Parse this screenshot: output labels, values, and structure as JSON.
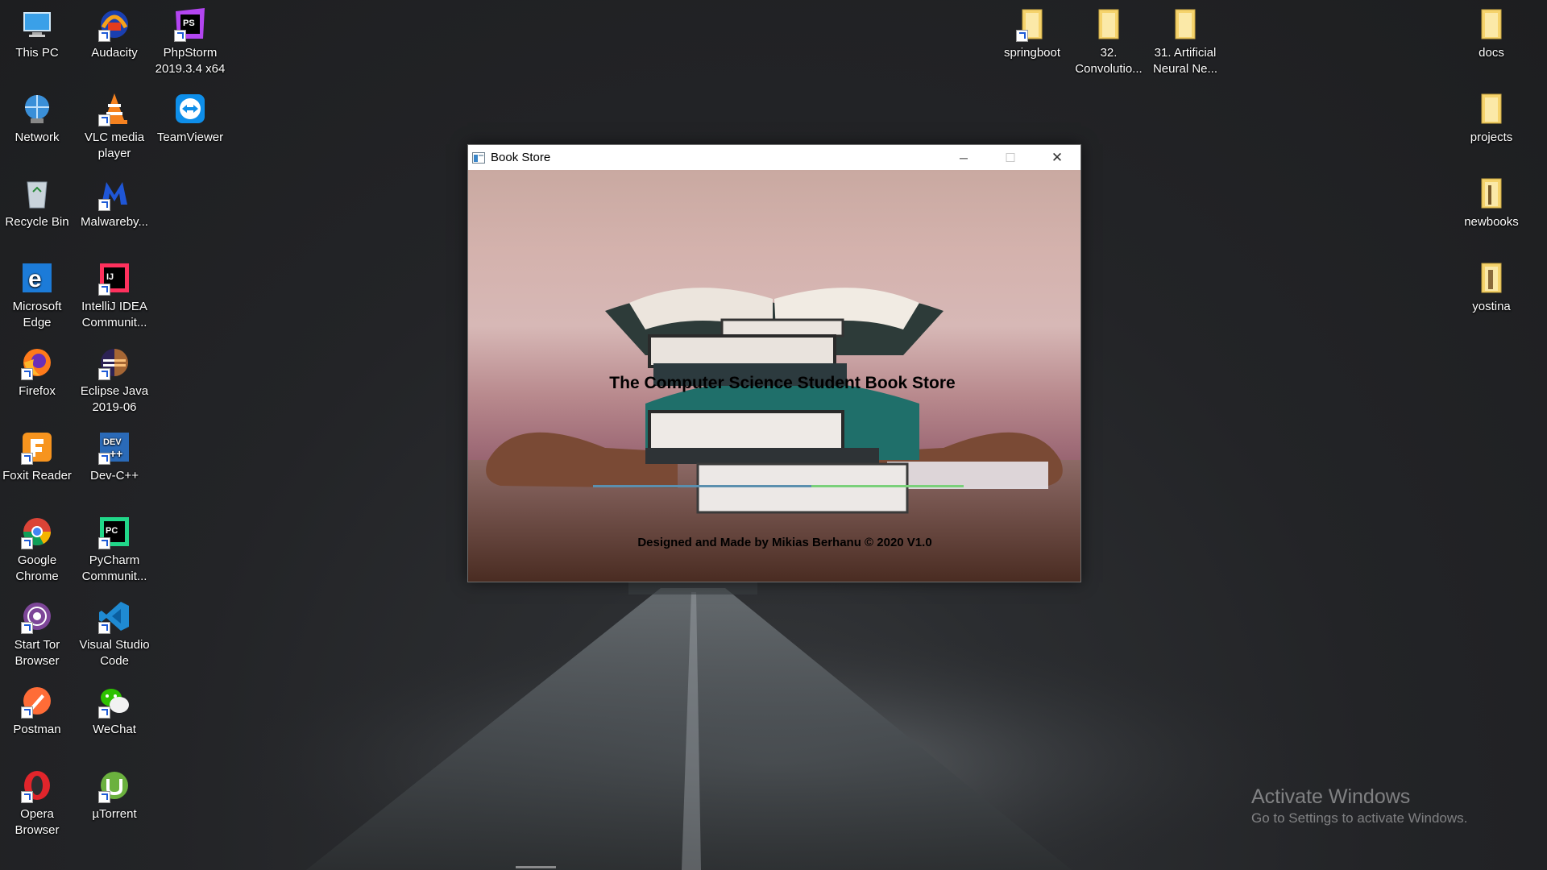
{
  "desktop": {
    "left_icons": [
      {
        "label": "This PC",
        "icon": "this-pc-icon"
      },
      {
        "label": "Audacity",
        "icon": "audacity-icon"
      },
      {
        "label": "PhpStorm 2019.3.4 x64",
        "icon": "phpstorm-icon"
      },
      {
        "label": "Network",
        "icon": "network-icon"
      },
      {
        "label": "VLC media player",
        "icon": "vlc-icon"
      },
      {
        "label": "TeamViewer",
        "icon": "teamviewer-icon"
      },
      {
        "label": "Recycle Bin",
        "icon": "recycle-bin-icon"
      },
      {
        "label": "Malwareby...",
        "icon": "malwarebytes-icon"
      },
      {
        "label": "Microsoft Edge",
        "icon": "edge-icon"
      },
      {
        "label": "IntelliJ IDEA Communit...",
        "icon": "intellij-icon"
      },
      {
        "label": "Firefox",
        "icon": "firefox-icon"
      },
      {
        "label": "Eclipse Java 2019-06",
        "icon": "eclipse-icon"
      },
      {
        "label": "Foxit Reader",
        "icon": "foxit-icon"
      },
      {
        "label": "Dev-C++",
        "icon": "devcpp-icon"
      },
      {
        "label": "Google Chrome",
        "icon": "chrome-icon"
      },
      {
        "label": "PyCharm Communit...",
        "icon": "pycharm-icon"
      },
      {
        "label": "Start Tor Browser",
        "icon": "tor-icon"
      },
      {
        "label": "Visual Studio Code",
        "icon": "vscode-icon"
      },
      {
        "label": "Postman",
        "icon": "postman-icon"
      },
      {
        "label": "WeChat",
        "icon": "wechat-icon"
      },
      {
        "label": "Opera Browser",
        "icon": "opera-icon"
      },
      {
        "label": "µTorrent",
        "icon": "utorrent-icon"
      }
    ],
    "top_folders": [
      {
        "label": "springboot",
        "icon": "folder-icon"
      },
      {
        "label": "32. Convolutio...",
        "icon": "folder-icon"
      },
      {
        "label": "31. Artificial Neural Ne...",
        "icon": "folder-icon"
      }
    ],
    "right_folders": [
      {
        "label": "docs",
        "icon": "folder-icon"
      },
      {
        "label": "projects",
        "icon": "folder-icon"
      },
      {
        "label": "newbooks",
        "icon": "folder-icon"
      },
      {
        "label": "yostina",
        "icon": "folder-icon"
      }
    ]
  },
  "window": {
    "title": "Book Store",
    "minimize_label": "─",
    "maximize_label": "☐",
    "close_label": "✕",
    "app_title": "The Computer Science Student Book Store",
    "footer": "Designed and Made by Mikias Berhanu © 2020 V1.0",
    "progress_fraction": 0.59
  },
  "watermark": {
    "line1": "Activate Windows",
    "line2": "Go to Settings to activate Windows."
  },
  "colors": {
    "progress_fill": "#5b8fae",
    "progress_track": "#7ad07a"
  }
}
